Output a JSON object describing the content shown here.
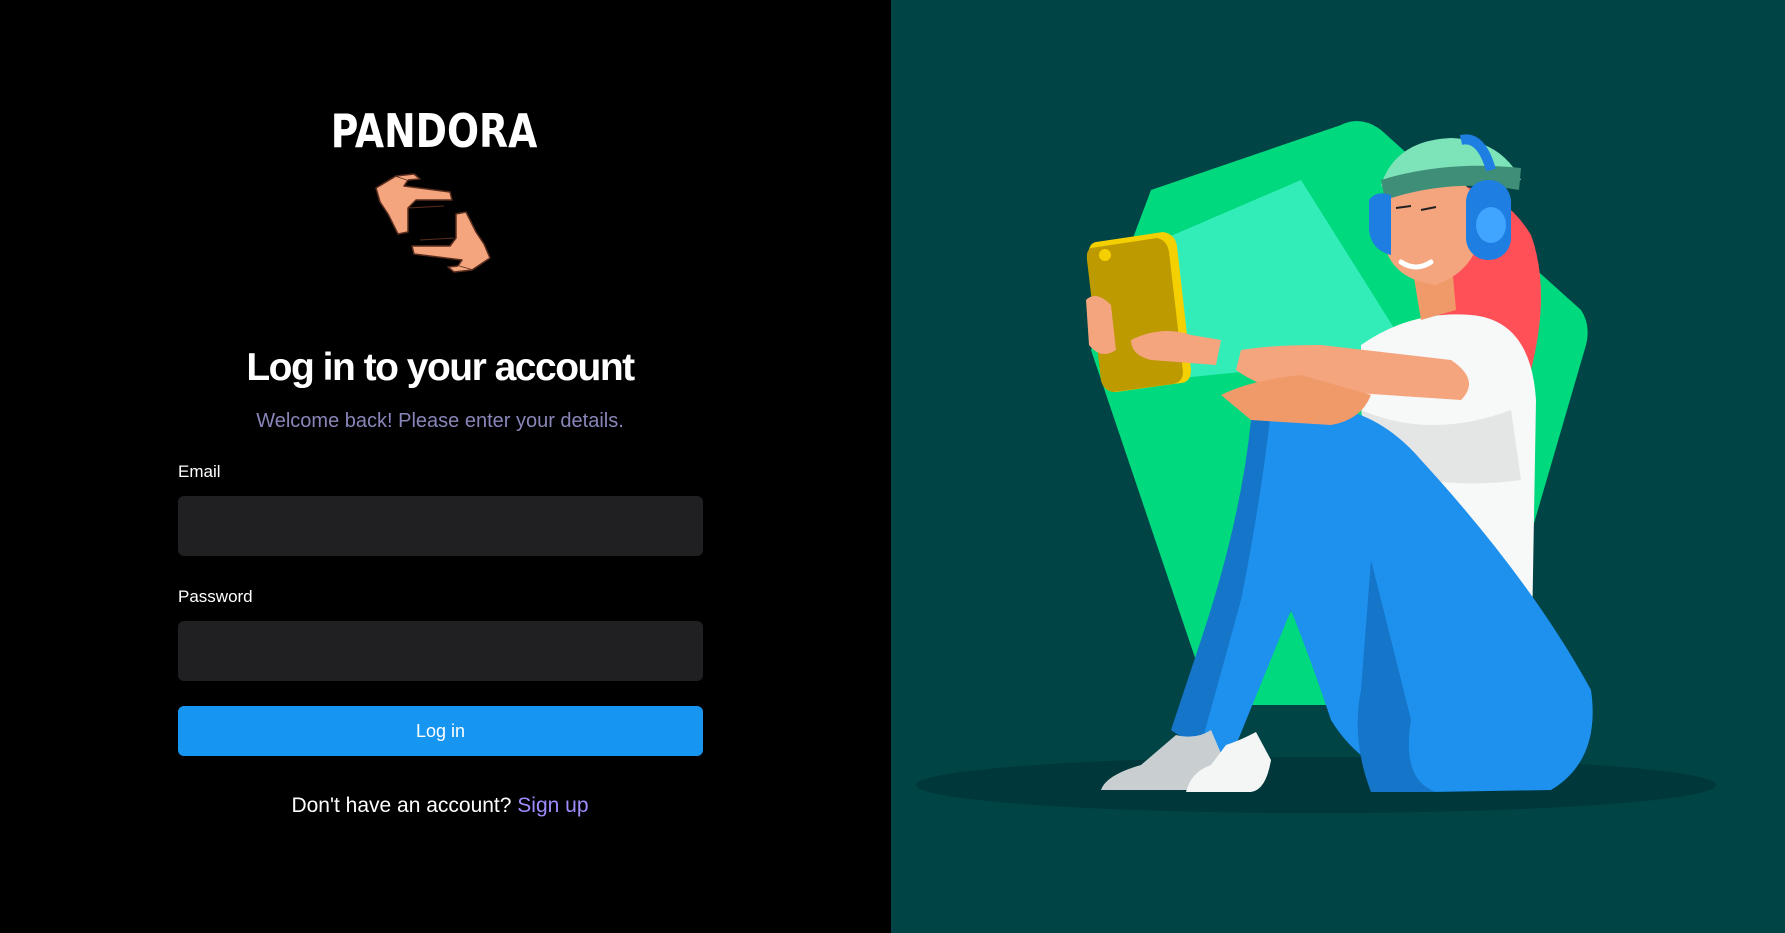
{
  "brand": {
    "logo_text": "PANDORA"
  },
  "login": {
    "heading": "Log in to your account",
    "subheading": "Welcome back! Please enter your details.",
    "email_label": "Email",
    "email_value": "",
    "email_placeholder": "",
    "password_label": "Password",
    "password_value": "",
    "password_placeholder": "",
    "submit_label": "Log in",
    "signup_prompt": "Don't have an account?",
    "signup_link": "Sign up"
  },
  "icons": {
    "logo": "framing-hands-icon",
    "illustration": "person-with-phone-and-headphones-illustration"
  },
  "colors": {
    "left_background": "#000000",
    "right_background": "#004445",
    "input_background": "#202022",
    "primary_button": "#1796f1",
    "subheading": "#8886b9",
    "link": "#9f8dff",
    "illustration_green": "#00d97e"
  }
}
